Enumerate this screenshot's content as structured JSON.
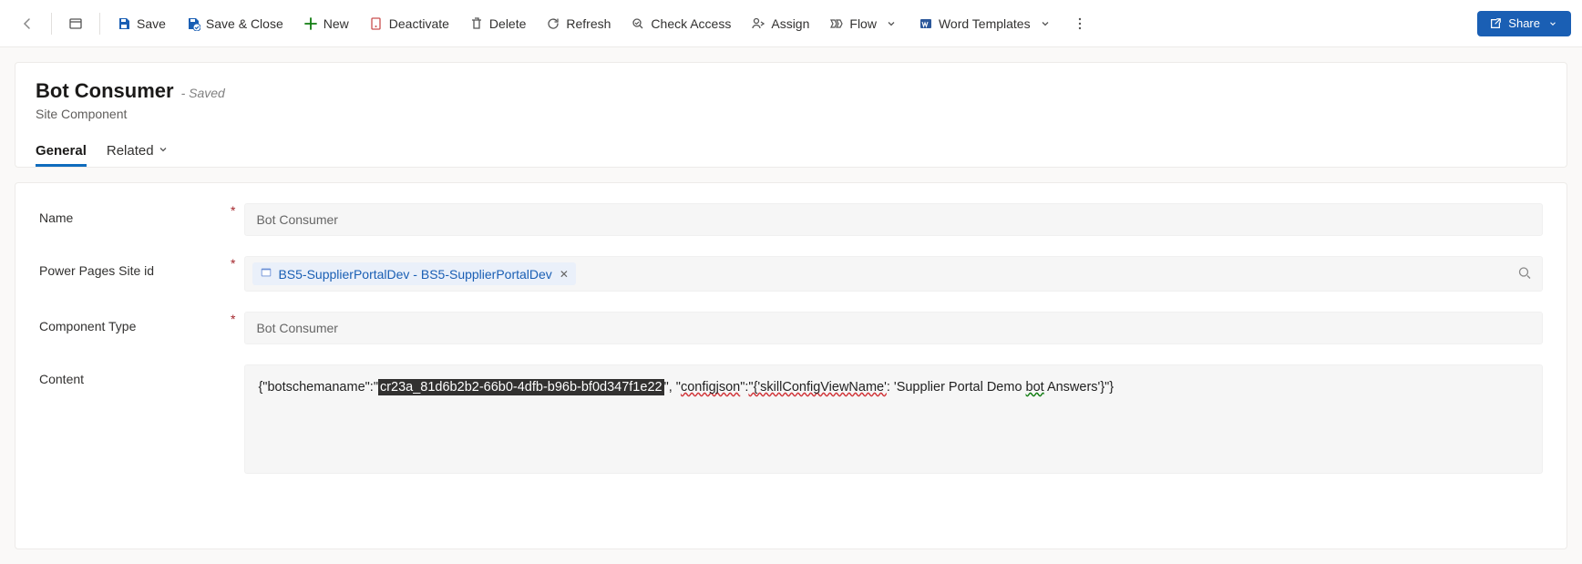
{
  "toolbar": {
    "back": "",
    "open": "",
    "save": "Save",
    "save_close": "Save & Close",
    "new": "New",
    "deactivate": "Deactivate",
    "delete": "Delete",
    "refresh": "Refresh",
    "check_access": "Check Access",
    "assign": "Assign",
    "flow": "Flow",
    "word_templates": "Word Templates",
    "share": "Share"
  },
  "header": {
    "title": "Bot Consumer",
    "status": "- Saved",
    "subtitle": "Site Component"
  },
  "tabs": {
    "general": "General",
    "related": "Related"
  },
  "fields": {
    "name_label": "Name",
    "name_value": "Bot Consumer",
    "site_label": "Power Pages Site id",
    "site_lookup_text": "BS5-SupplierPortalDev - BS5-SupplierPortalDev",
    "comp_type_label": "Component Type",
    "comp_type_value": "Bot Consumer",
    "content_label": "Content",
    "content_parts": {
      "p1": "{\"botschemaname\":\"",
      "hl": "cr23a_81d6b2b2-66b0-4dfb-b96b-bf0d347f1e22",
      "p2": "\", \"",
      "spell1": "configjson",
      "p3": "\":",
      "spell2": "\"{'skillConfigViewName'",
      "p4": ": 'Supplier Portal Demo ",
      "spell3": "bot",
      "p5": " Answers'}\"}"
    }
  }
}
